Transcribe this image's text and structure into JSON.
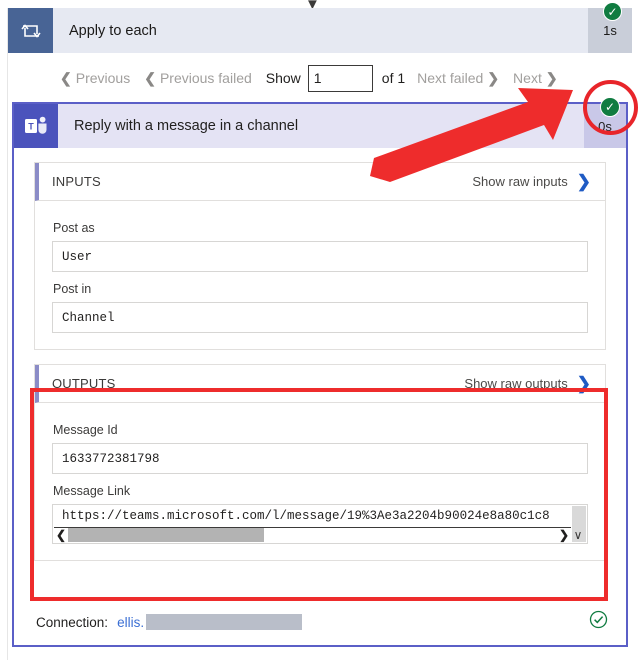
{
  "loop": {
    "title": "Apply to each",
    "duration": "1s",
    "icon": "loop-repeat-icon",
    "status": "succeeded"
  },
  "pager": {
    "previous": "Previous",
    "previous_failed": "Previous failed",
    "show_label": "Show",
    "current_page": "1",
    "of_label": "of 1",
    "next_failed": "Next failed",
    "next": "Next"
  },
  "action": {
    "title": "Reply with a message in a channel",
    "duration": "0s",
    "icon": "microsoft-teams-icon",
    "status": "succeeded"
  },
  "inputs": {
    "heading": "INPUTS",
    "show_raw": "Show raw inputs",
    "fields": [
      {
        "label": "Post as",
        "value": "User"
      },
      {
        "label": "Post in",
        "value": "Channel"
      }
    ]
  },
  "outputs": {
    "heading": "OUTPUTS",
    "show_raw": "Show raw outputs",
    "message_id": {
      "label": "Message Id",
      "value": "1633772381798"
    },
    "message_link": {
      "label": "Message Link",
      "value": "https://teams.microsoft.com/l/message/19%3Ae3a2204b90024e8a80c1c8"
    }
  },
  "connection": {
    "label": "Connection:",
    "user": "ellis.",
    "redacted": true
  },
  "colors": {
    "loop_icon_bg": "#486495",
    "loop_header_bg": "#e6e9f2",
    "teams_icon_bg": "#4b53bc",
    "card_header_bg": "#e4e3f4",
    "card_border": "#5b5fc7",
    "success_green": "#107c41",
    "annotation_red": "#ee2c2c",
    "link_blue": "#3b6fd4"
  }
}
